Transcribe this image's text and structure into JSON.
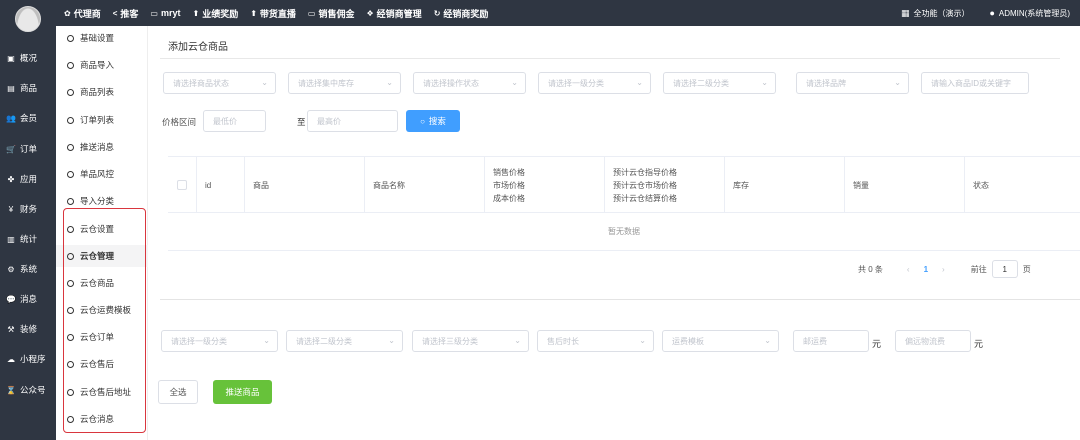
{
  "topbar": {
    "nav": [
      {
        "icon": "gear-icon",
        "glyph": "✿",
        "label": "代理商"
      },
      {
        "icon": "share-icon",
        "glyph": "<",
        "label": "推客"
      },
      {
        "icon": "card-icon",
        "glyph": "▭",
        "label": "mryt"
      },
      {
        "icon": "arrow-up-icon",
        "glyph": "⬆",
        "label": "业绩奖励"
      },
      {
        "icon": "arrow-up-icon",
        "glyph": "⬆",
        "label": "带货直播"
      },
      {
        "icon": "card-icon",
        "glyph": "▭",
        "label": "销售佣金"
      },
      {
        "icon": "handshake-icon",
        "glyph": "❖",
        "label": "经销商管理"
      },
      {
        "icon": "refresh-icon",
        "glyph": "↻",
        "label": "经销商奖励"
      }
    ],
    "right": [
      {
        "icon": "grid-icon",
        "glyph": "▦",
        "label": "全功能（演示）"
      },
      {
        "icon": "user-icon",
        "glyph": "●",
        "label": "ADMIN(系统管理员)"
      }
    ]
  },
  "sidebar": {
    "items": [
      {
        "icon": "overview-icon",
        "glyph": "▣",
        "label": "概况"
      },
      {
        "icon": "goods-icon",
        "glyph": "▤",
        "label": "商品"
      },
      {
        "icon": "members-icon",
        "glyph": "👥",
        "label": "会员"
      },
      {
        "icon": "cart-icon",
        "glyph": "🛒",
        "label": "订单"
      },
      {
        "icon": "apps-icon",
        "glyph": "✤",
        "label": "应用"
      },
      {
        "icon": "yen-icon",
        "glyph": "¥",
        "label": "财务"
      },
      {
        "icon": "bar-chart-icon",
        "glyph": "▥",
        "label": "统计"
      },
      {
        "icon": "gears-icon",
        "glyph": "⚙",
        "label": "系统"
      },
      {
        "icon": "message-icon",
        "glyph": "💬",
        "label": "消息"
      },
      {
        "icon": "hammer-icon",
        "glyph": "⚒",
        "label": "装修"
      },
      {
        "icon": "wechat-icon",
        "glyph": "☁",
        "label": "小程序"
      },
      {
        "icon": "hourglass-icon",
        "glyph": "⌛",
        "label": "公众号"
      }
    ]
  },
  "submenu": {
    "items": [
      {
        "label": "基础设置"
      },
      {
        "label": "商品导入"
      },
      {
        "label": "商品列表"
      },
      {
        "label": "订单列表"
      },
      {
        "label": "推送消息"
      },
      {
        "label": "单品风控"
      },
      {
        "label": "导入分类"
      },
      {
        "label": "云仓设置"
      },
      {
        "label": "云仓管理"
      },
      {
        "label": "云仓商品"
      },
      {
        "label": "云仓运费模板"
      },
      {
        "label": "云仓订单"
      },
      {
        "label": "云仓售后"
      },
      {
        "label": "云仓售后地址"
      },
      {
        "label": "云仓消息"
      }
    ]
  },
  "main": {
    "title": "添加云仓商品",
    "filters": {
      "goods_status": "请选择商品状态",
      "stock": "请选择集中库存",
      "op_status": "请选择操作状态",
      "cat1": "请选择一级分类",
      "cat2": "请选择二级分类",
      "brand": "请选择品牌",
      "keyword": "请输入商品ID或关键字"
    },
    "price_range": {
      "label": "价格区间",
      "min": "最低价",
      "to": "至",
      "max": "最高价"
    },
    "search_label": "搜索",
    "table": {
      "columns": {
        "id": "id",
        "goods": "商品",
        "name": "商品名称",
        "price1": "销售价格",
        "price2": "市场价格",
        "price3": "成本价格",
        "cloud1": "预计云仓指导价格",
        "cloud2": "预计云仓市场价格",
        "cloud3": "预计云仓结算价格",
        "stock": "库存",
        "sales": "销量",
        "status": "状态"
      },
      "empty": "暂无数据"
    },
    "pager": {
      "total": "共 0 条",
      "prev": "‹",
      "page": "1",
      "next": "›",
      "goto": "前往",
      "goto_value": "1",
      "page_unit": "页"
    },
    "bottom_filters": {
      "cat1": "请选择一级分类",
      "cat2": "请选择二级分类",
      "cat3": "请选择三级分类",
      "aftersale": "售后时长",
      "freight_tpl": "运费模板",
      "freight": "邮运费",
      "freight_unit": "元",
      "remote_freight": "偏远物流费",
      "remote_unit": "元"
    },
    "select_all": "全选",
    "push": "推送商品"
  }
}
